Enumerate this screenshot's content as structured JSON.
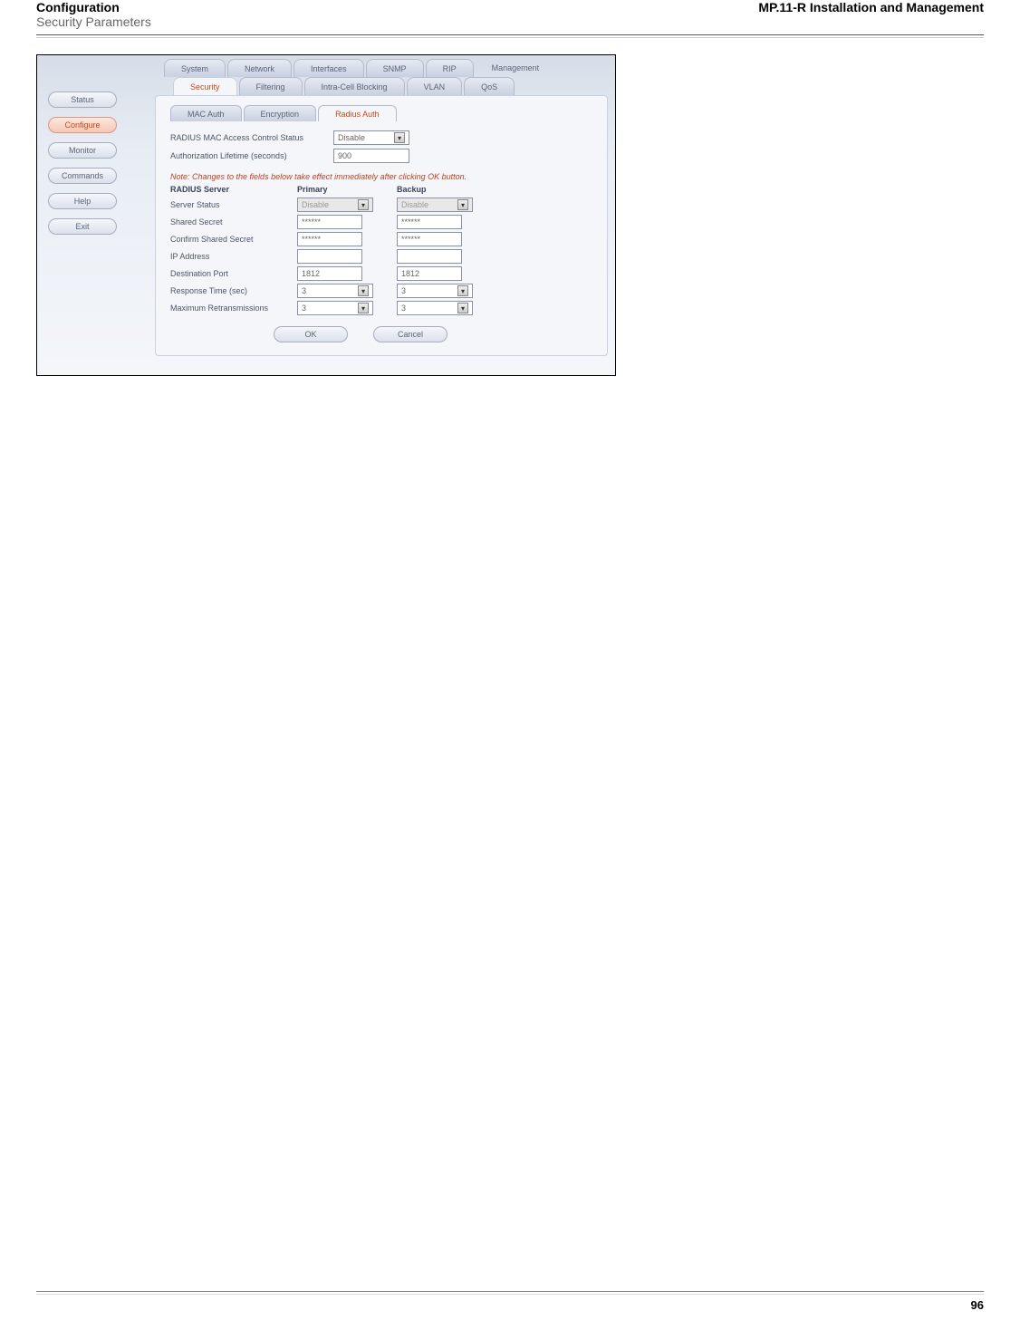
{
  "header": {
    "left_bold": "Configuration",
    "left_sub": "Security Parameters",
    "right": "MP.11-R Installation and Management"
  },
  "leftnav": [
    "Status",
    "Configure",
    "Monitor",
    "Commands",
    "Help",
    "Exit"
  ],
  "tabs_top": [
    "System",
    "Network",
    "Interfaces",
    "SNMP",
    "RIP",
    "Management"
  ],
  "tabs_mid": [
    "Security",
    "Filtering",
    "Intra-Cell Blocking",
    "VLAN",
    "QoS"
  ],
  "subtabs": [
    "MAC Auth",
    "Encryption",
    "Radius Auth"
  ],
  "form": {
    "radius_mac_label": "RADIUS MAC Access Control Status",
    "radius_mac_value": "Disable",
    "auth_life_label": "Authorization Lifetime (seconds)",
    "auth_life_value": "900",
    "note": "Note: Changes to the fields below take effect immediately after clicking OK button.",
    "table_header": {
      "c1": "RADIUS Server",
      "c2": "Primary",
      "c3": "Backup"
    },
    "rows": [
      {
        "label": "Server Status",
        "p": "Disable",
        "b": "Disable",
        "type": "select-disabled"
      },
      {
        "label": "Shared Secret",
        "p": "******",
        "b": "******",
        "type": "text"
      },
      {
        "label": "Confirm Shared Secret",
        "p": "******",
        "b": "******",
        "type": "text"
      },
      {
        "label": "IP Address",
        "p": "",
        "b": "",
        "type": "text"
      },
      {
        "label": "Destination Port",
        "p": "1812",
        "b": "1812",
        "type": "text"
      },
      {
        "label": "Response Time (sec)",
        "p": "3",
        "b": "3",
        "type": "select"
      },
      {
        "label": "Maximum Retransmissions",
        "p": "3",
        "b": "3",
        "type": "select"
      }
    ],
    "ok": "OK",
    "cancel": "Cancel"
  },
  "footer": {
    "page": "96"
  }
}
